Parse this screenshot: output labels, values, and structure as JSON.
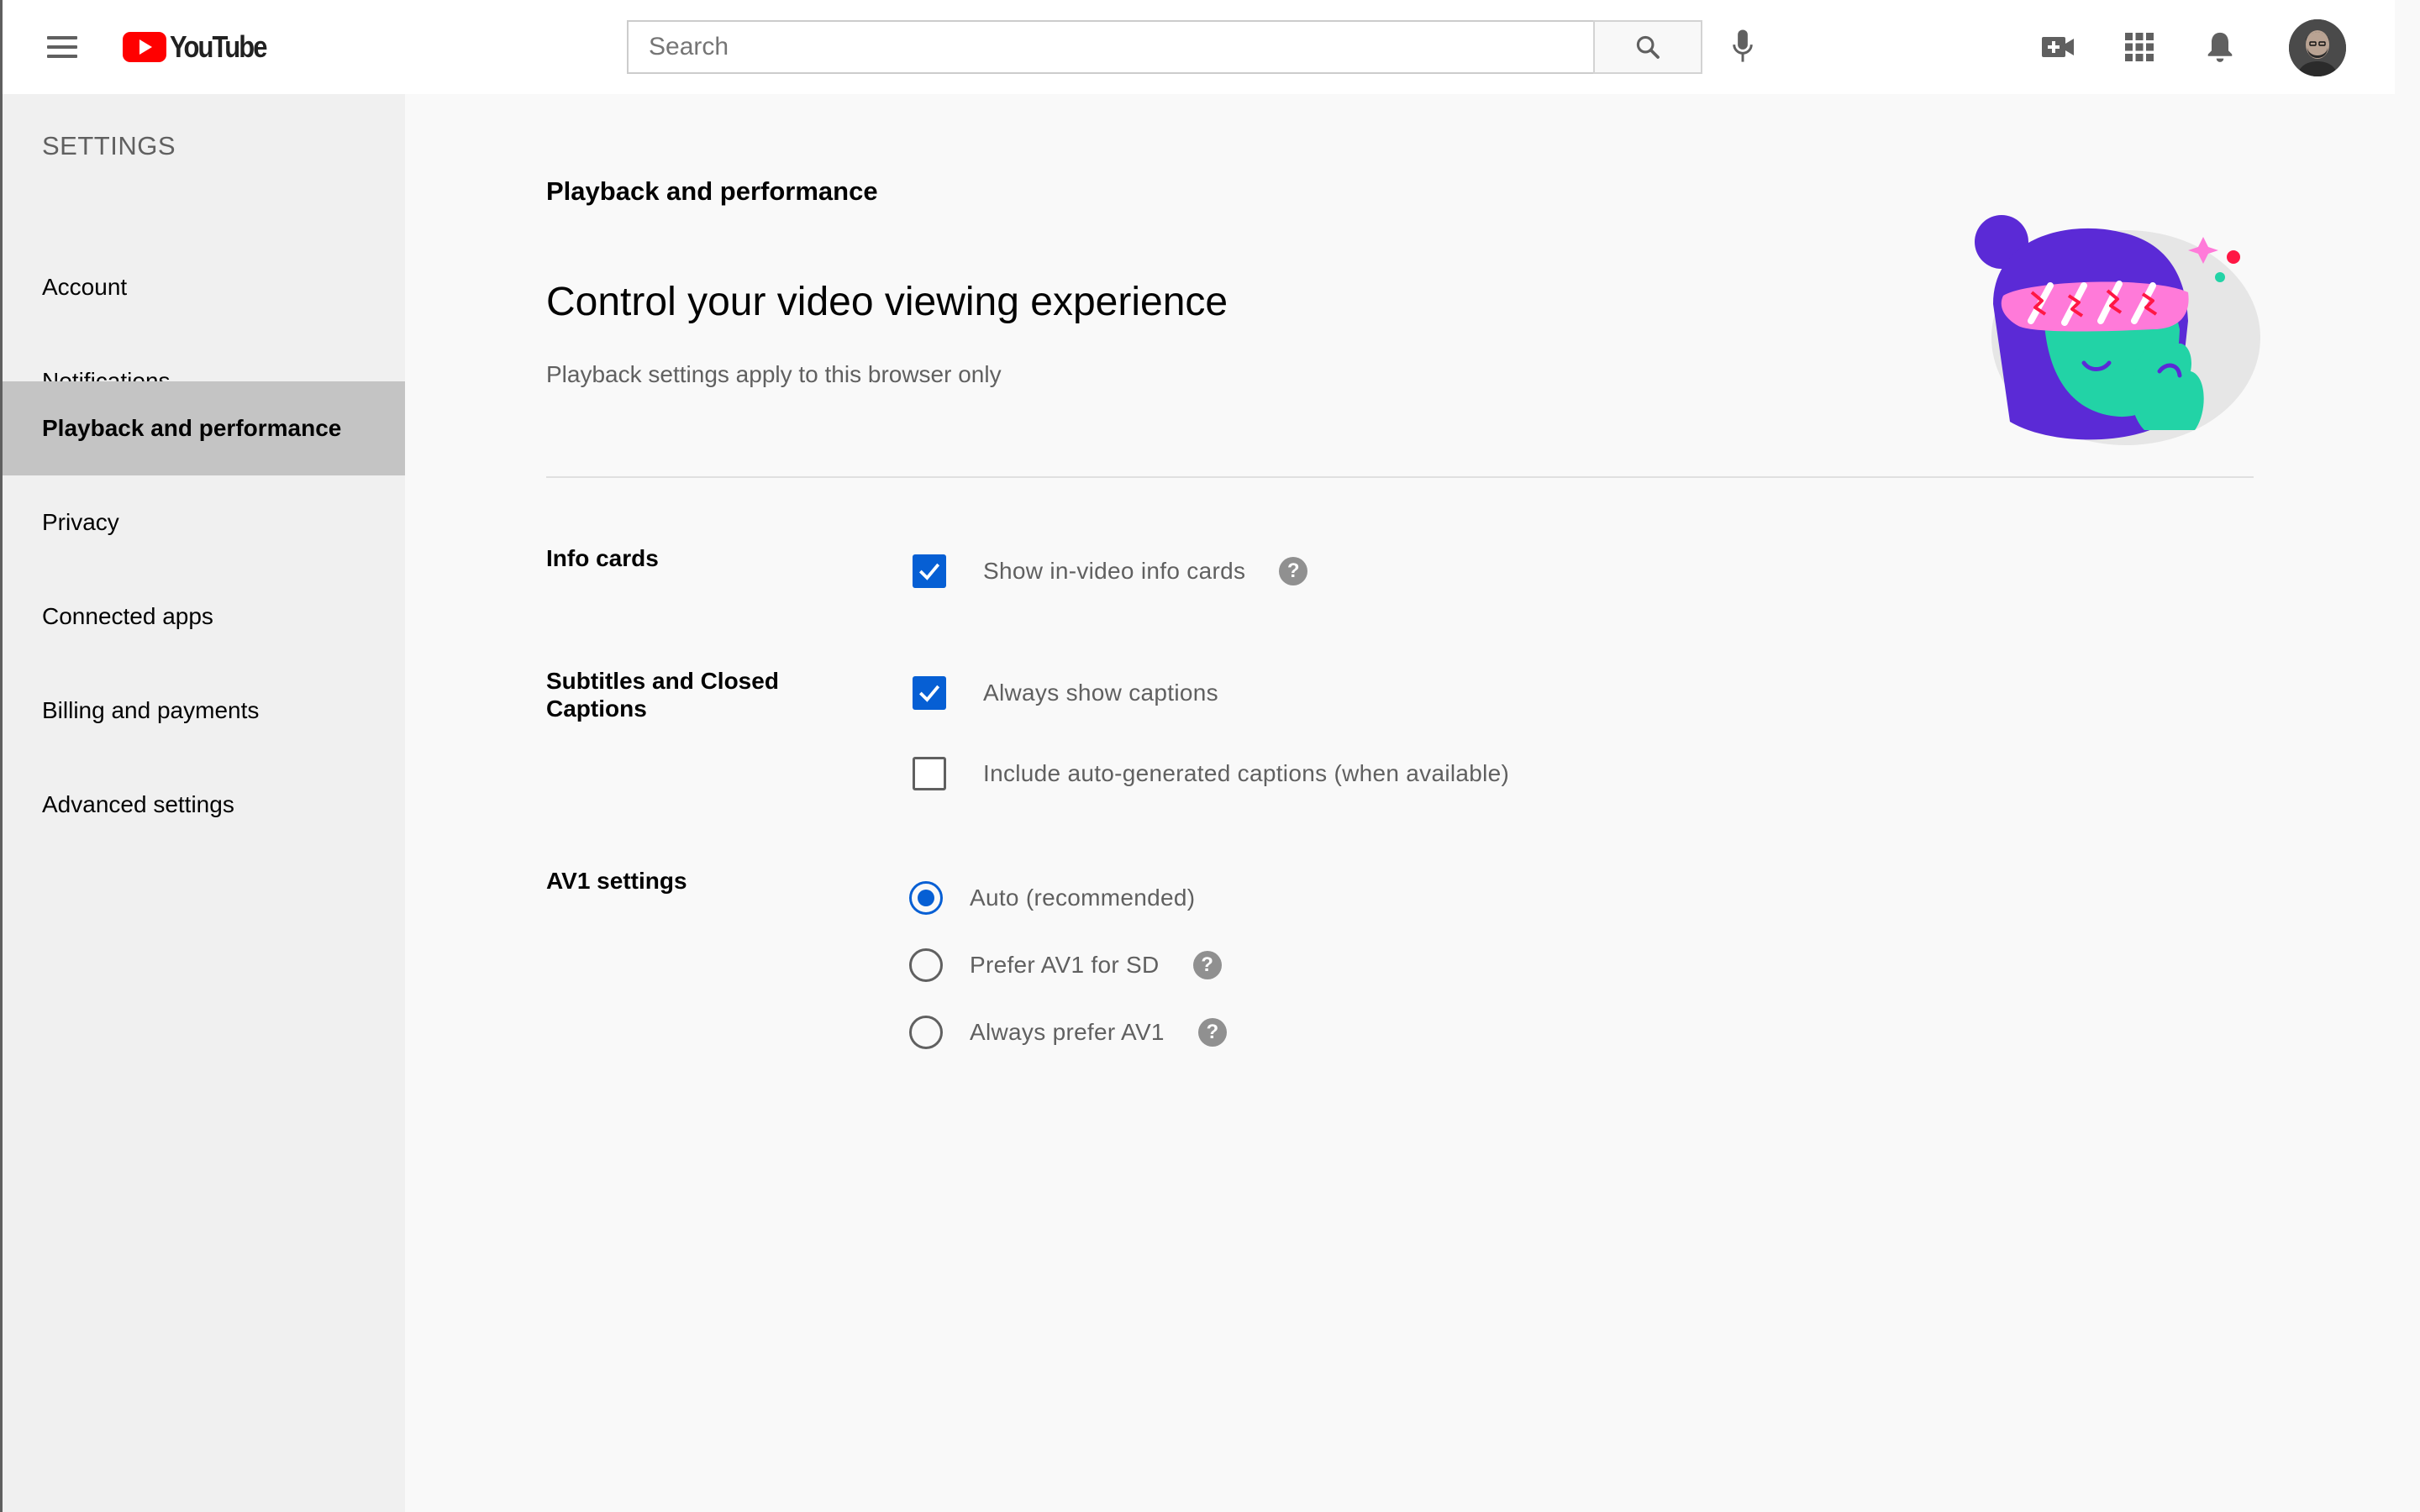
{
  "header": {
    "logo_text": "YouTube",
    "search_placeholder": "Search",
    "icons": [
      "menu-icon",
      "search-icon",
      "microphone-icon",
      "create-video-icon",
      "apps-grid-icon",
      "notifications-bell-icon",
      "avatar"
    ]
  },
  "sidebar": {
    "title": "SETTINGS",
    "items": [
      {
        "label": "Account"
      },
      {
        "label": "Notifications"
      },
      {
        "label": "Playback and performance",
        "active": true
      },
      {
        "label": "Privacy"
      },
      {
        "label": "Connected apps"
      },
      {
        "label": "Billing and payments"
      },
      {
        "label": "Advanced settings"
      }
    ]
  },
  "main": {
    "section_label": "Playback and performance",
    "heading": "Control your video viewing experience",
    "subheading": "Playback settings apply to this browser only",
    "info_cards": {
      "label": "Info cards",
      "option": {
        "text": "Show in-video info cards",
        "checked": true,
        "has_help": true
      }
    },
    "subtitles": {
      "label": "Subtitles and Closed Captions",
      "options": [
        {
          "text": "Always show captions",
          "checked": true
        },
        {
          "text": "Include auto-generated captions (when available)",
          "checked": false
        }
      ]
    },
    "av1": {
      "label": "AV1 settings",
      "options": [
        {
          "text": "Auto (recommended)",
          "selected": true,
          "has_help": false
        },
        {
          "text": "Prefer AV1 for SD",
          "selected": false,
          "has_help": true
        },
        {
          "text": "Always prefer AV1",
          "selected": false,
          "has_help": true
        }
      ]
    },
    "help_glyph": "?"
  },
  "colors": {
    "accent": "#065fd4",
    "brand_red": "#ff0000",
    "active_sidebar_bg": "#c4c4c4",
    "sidebar_bg": "#f0f0f0",
    "page_bg": "#f9f9f9"
  }
}
